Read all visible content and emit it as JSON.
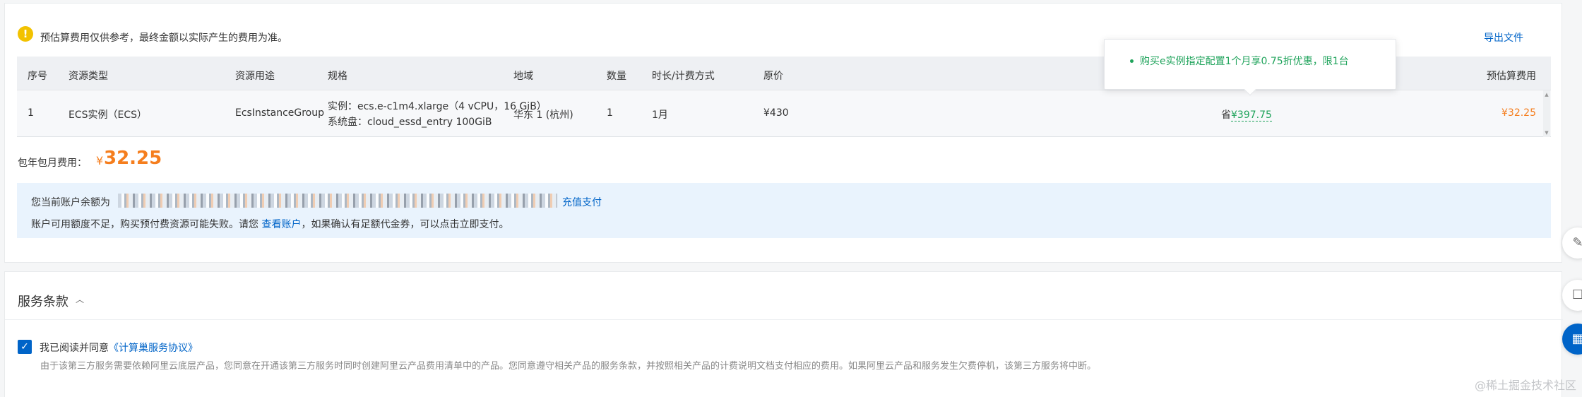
{
  "notice": {
    "icon": "warning-icon",
    "text": "预估算费用仅供参考，最终金额以实际产生的费用为准。",
    "export_label": "导出文件"
  },
  "table": {
    "columns": [
      "序号",
      "资源类型",
      "资源用途",
      "规格",
      "地域",
      "数量",
      "时长/计费方式",
      "原价",
      "预估算费用"
    ],
    "row": {
      "index": "1",
      "type": "ECS实例（ECS）",
      "usage": "EcsInstanceGroup",
      "spec_instance": "实例：ecs.e-c1m4.xlarge（4 vCPU，16 GiB）",
      "spec_disk": "系统盘：cloud_essd_entry 100GiB",
      "region": "华东 1 (杭州)",
      "quantity": "1",
      "duration": "1月",
      "original_price": "¥430",
      "discount_prefix": "省",
      "discount_amount": "¥397.75",
      "estimated_cost": "¥32.25"
    }
  },
  "tooltip": {
    "text": "购买e实例指定配置1个月享0.75折优惠，限1台"
  },
  "total": {
    "label": "包年包月费用：",
    "currency": "¥",
    "value": "32.25"
  },
  "balance": {
    "line1_prefix": "您当前账户余额为",
    "recharge_label": "充值支付",
    "line2_prefix": "账户可用额度不足，购买预付费资源可能失败。请您 ",
    "view_account_label": "查看账户",
    "line2_suffix": "，如果确认有足额代金券，可以点击立即支付。"
  },
  "terms": {
    "title": "服务条款",
    "agree_prefix": "我已阅读并同意",
    "agreement_link": "《计算巢服务协议》",
    "description": "由于该第三方服务需要依赖阿里云底层产品，您同意在开通该第三方服务时同时创建阿里云产品费用清单中的产品。您同意遵守相关产品的服务条款，并按照相关产品的计费说明文档支付相应的费用。如果阿里云产品和服务发生欠费停机，该第三方服务将中断。"
  },
  "side_buttons": [
    "edit-icon",
    "feedback-icon",
    "grid-icon"
  ],
  "watermark": "@稀土掘金技术社区",
  "colors": {
    "accent_blue": "#0064c8",
    "price_orange": "#f57e1e",
    "discount_green": "#1fa35b",
    "warning_yellow": "#f2c200"
  }
}
